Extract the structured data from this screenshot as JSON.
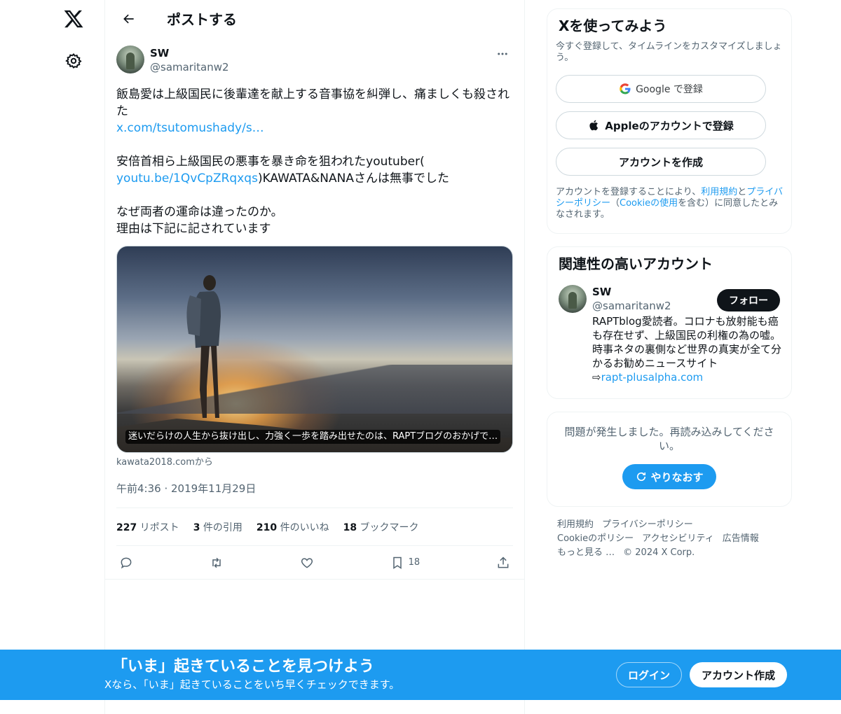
{
  "nav": {
    "logo_icon": "x-logo-icon",
    "settings_icon": "gear-icon"
  },
  "header": {
    "title": "ポストする"
  },
  "post": {
    "author_name": "SW",
    "author_handle": "@samaritanw2",
    "text_line1": "飯島愛は上級国民に後輩達を献上する音事協を糾弾し、痛ましくも殺された",
    "link1": "x.com/tsutomushady/s…",
    "text_line2": "安倍首相ら上級国民の悪事を暴き命を狙われたyoutuber(",
    "link2": "youtu.be/1QvCpZRqxqs",
    "text_line2b": ")KAWATA&NANAさんは無事でした",
    "text_line3": "なぜ両者の運命は違ったのか。",
    "text_line4": "理由は下記に記されています",
    "media_caption": "迷いだらけの人生から抜け出し、力強く一歩を踏み出せたのは、RAPTブログのおかげで…",
    "media_source": "kawata2018.comから",
    "timestamp": "午前4:36 · 2019年11月29日",
    "stats": {
      "reposts_count": "227",
      "reposts_label": "リポスト",
      "quotes_count": "3",
      "quotes_label": "件の引用",
      "likes_count": "210",
      "likes_label": "件のいいね",
      "bookmarks_count": "18",
      "bookmarks_label": "ブックマーク"
    },
    "bookmark_action_count": "18"
  },
  "signup": {
    "title": "Xを使ってみよう",
    "desc": "今すぐ登録して、タイムラインをカスタマイズしましょう。",
    "google_label": "Google で登録",
    "apple_label": "Appleのアカウントで登録",
    "create_label": "アカウントを作成",
    "terms_prefix": "アカウントを登録することにより、",
    "terms_link1": "利用規約",
    "terms_mid1": "と",
    "terms_link2": "プライバシーポリシー",
    "terms_mid2": "（",
    "terms_link3": "Cookieの使用",
    "terms_suffix": "を含む）に同意したとみなされます。"
  },
  "related": {
    "title": "関連性の高いアカウント",
    "name": "SW",
    "handle": "@samaritanw2",
    "follow_label": "フォロー",
    "bio": "RAPTblog愛読者。コロナも放射能も癌も存在せず、上級国民の利権の為の嘘。時事ネタの裏側など世界の真実が全て分かるお勧めニュースサイト",
    "bio_link_prefix": "⇨",
    "bio_link": "rapt-plusalpha.com"
  },
  "error": {
    "text": "問題が発生しました。再読み込みしてください。",
    "retry_label": "やりなおす"
  },
  "footer": {
    "links": [
      "利用規約",
      "プライバシーポリシー",
      "Cookieのポリシー",
      "アクセシビリティ",
      "広告情報",
      "もっと見る …"
    ],
    "copyright": "© 2024 X Corp."
  },
  "banner": {
    "title": "「いま」起きていることを見つけよう",
    "subtitle": "Xなら、「いま」起きていることをいち早くチェックできます。",
    "login_label": "ログイン",
    "create_label": "アカウント作成"
  },
  "colors": {
    "accent": "#1d9bf0",
    "text": "#0f1419",
    "muted": "#536471"
  }
}
